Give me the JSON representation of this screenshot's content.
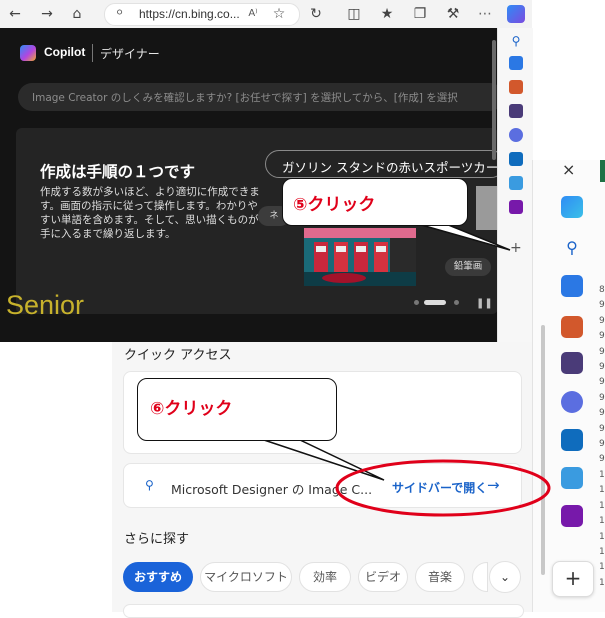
{
  "browser": {
    "url": "https://cn.bing.co...",
    "read_aloud_label": "A⁾"
  },
  "copilot": {
    "title": "Copilot",
    "section": "デザイナー",
    "prompt_placeholder": "Image Creator のしくみを確認しますか? [お任せで探す] を選択してから、[作成] を選択",
    "card_heading": "作成は手順の１つです",
    "card_body": "作成する数が多いほど、より適切に作成できます。画面の指示に従って操作します。わかりやすい単語を含めます。そして、思い描くものが手に入るまで繰り返します。",
    "example_prompt": "ガソリン スタンドの赤いスポーツカー",
    "chip_left": "ネ",
    "chip_right": "鉛筆画"
  },
  "watermark": "Senior",
  "callouts": {
    "step5": "⑤クリック",
    "step6": "⑥クリック"
  },
  "quick_access": {
    "heading": "クイック アクセス",
    "row_text": "Microsoft Designer の Image C...",
    "row_action": "サイドバーで開く",
    "explore_heading": "さらに探す",
    "pills": [
      "おすすめ",
      "マイクロソフト",
      "効率",
      "ビデオ",
      "音楽"
    ]
  },
  "sidebar": {
    "add_symbol": "+",
    "close_symbol": "×"
  },
  "row_numbers": [
    "8",
    "9",
    "9",
    "9",
    "9",
    "9",
    "9",
    "9",
    "9",
    "9",
    "9",
    "9",
    "1",
    "1",
    "1",
    "1",
    "1",
    "1",
    "1",
    "1"
  ],
  "colors": {
    "accent_blue": "#1a63d9",
    "callout_red": "#e0001a",
    "watermark": "#c7b22c"
  }
}
